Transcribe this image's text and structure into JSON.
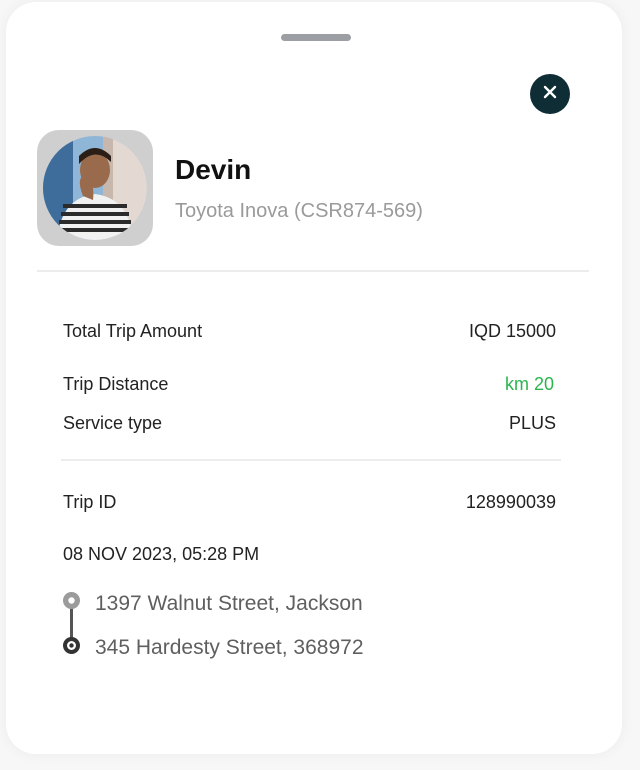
{
  "driver": {
    "name": "Devin",
    "vehicle": "Toyota Inova (CSR874-569)"
  },
  "trip": {
    "total_amount_label": "Total Trip Amount",
    "total_amount_value": "IQD 15000",
    "distance_label": "Trip Distance",
    "distance_value": "km 20",
    "service_type_label": "Service type",
    "service_type_value": "PLUS",
    "trip_id_label": "Trip ID",
    "trip_id_value": "128990039",
    "datetime": "08 NOV 2023, 05:28 PM",
    "pickup_address": "1397  Walnut Street, Jackson",
    "dropoff_address": "345 Hardesty Street, 368972"
  },
  "icons": {
    "close": "close-icon",
    "avatar": "driver-avatar",
    "pickup": "pickup-pin-icon",
    "dropoff": "dropoff-pin-icon"
  },
  "colors": {
    "close_button": "#0e2d35",
    "distance_value": "#2bb54f"
  }
}
